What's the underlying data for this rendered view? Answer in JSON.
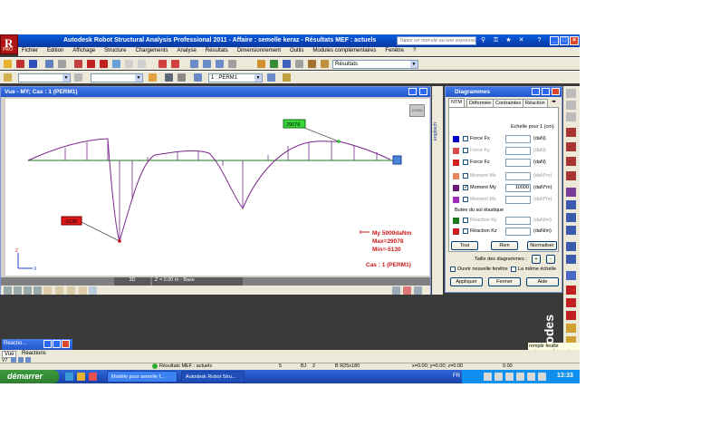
{
  "window": {
    "title": "Autodesk Robot Structural Analysis Professional 2011 - Affaire : semelle keraz - Résultats MEF : actuels",
    "help_placeholder": "Tapez un mot-clé ou une expressio",
    "logo_label": "PRO"
  },
  "menu": [
    "Fichier",
    "Edition",
    "Affichage",
    "Structure",
    "Chargements",
    "Analyse",
    "Résultats",
    "Dimensionnement",
    "Outils",
    "Modules complémentaires",
    "Fenêtre",
    "?"
  ],
  "toolbar": {
    "results_combo": "Résultats",
    "case_combo": "1 : PERM1"
  },
  "view": {
    "title": "Vue - MY; Cas : 1 (PERM1)",
    "legend": {
      "series": "My  5000daNm",
      "max": "Max=29078",
      "min": "Min=-5130",
      "case": "Cas : 1 (PERM1)"
    },
    "labels": {
      "min_value": "-5130",
      "max_value": "29078"
    },
    "mode_3d": "3D",
    "plane": "Z = 0.00 m - Base",
    "corner_btn": "ZOOM"
  },
  "side_strip_label": "englisch",
  "diagrams": {
    "title": "Diagrammes",
    "tabs": [
      "NTM",
      "Déformée",
      "Contraintes",
      "Réaction"
    ],
    "scale_label": "Echelle pour 1  (cm)",
    "rows": [
      {
        "label": "Force Fx",
        "color": "#0000cc",
        "value": "",
        "unit": "(daN)",
        "enabled": true,
        "checked": false
      },
      {
        "label": "Force Fy",
        "color": "#d94b4b",
        "value": "",
        "unit": "(daN)",
        "enabled": false,
        "checked": false
      },
      {
        "label": "Force Fz",
        "color": "#d42020",
        "value": "",
        "unit": "(daN)",
        "enabled": true,
        "checked": false
      },
      {
        "label": "Moment Mx",
        "color": "#e8875f",
        "value": "",
        "unit": "(daN*m)",
        "enabled": false,
        "checked": false
      },
      {
        "label": "Moment My",
        "color": "#6b1a78",
        "value": "10000",
        "unit": "(daN*m)",
        "enabled": true,
        "checked": true
      },
      {
        "label": "Moment Mz",
        "color": "#9d2cb8",
        "value": "",
        "unit": "(daN*m)",
        "enabled": false,
        "checked": false
      }
    ],
    "soil_label": "Butée du sol élastique",
    "soil_rows": [
      {
        "label": "Réaction Ky",
        "color": "#1e7a1e",
        "unit": "(daN/m)",
        "enabled": false
      },
      {
        "label": "Réaction Kz",
        "color": "#cc1e1e",
        "unit": "(daN/m)",
        "enabled": true
      }
    ],
    "buttons_top": [
      "Tout",
      "Rien",
      "Normaliser"
    ],
    "size_label": "Taille des diagrammes :",
    "open_new_window": "Ouvrir nouvelle fenêtre",
    "same_scale": "La même échelle",
    "buttons_bottom": [
      "Appliquer",
      "Fermer",
      "Aide"
    ]
  },
  "lower": {
    "reactions_title": "Réactio...",
    "tip": "remplir feuille présence chaque jour",
    "brand": "Autodes",
    "tabs": [
      "Vue",
      "Réactions"
    ]
  },
  "statusbar": {
    "results": "Résultats MEF : actuels",
    "n1": "5",
    "n2": "BJ",
    "n3": "2",
    "section": "B R25x180",
    "coords": "x=0.00; y=0.00; z=0.00",
    "value": "0.00"
  },
  "taskbar": {
    "start": "démarrer",
    "tasks": [
      "Modèle pour semelle f...",
      "Autodesk Robot Stru..."
    ],
    "lang": "FR",
    "clock": "13:33"
  }
}
